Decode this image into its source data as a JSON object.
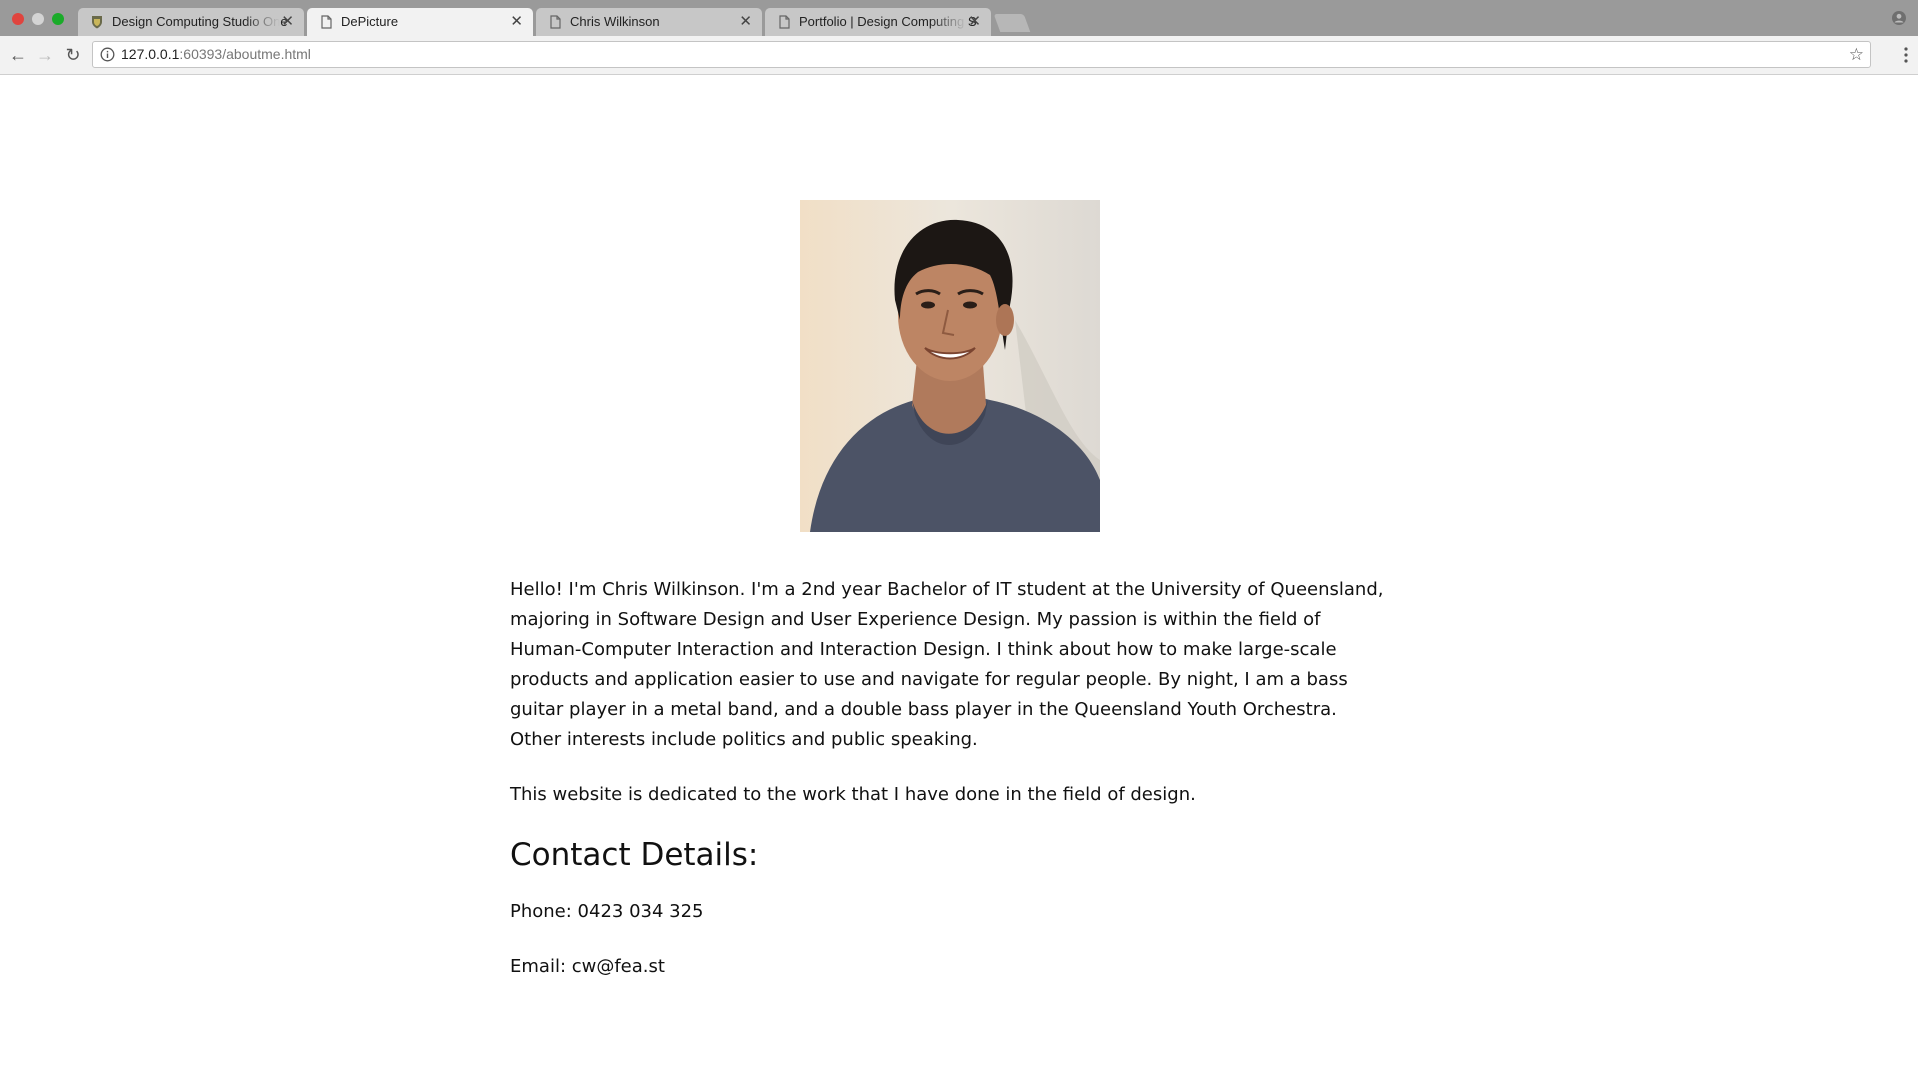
{
  "browser": {
    "tabs": [
      {
        "title": "Design Computing Studio One",
        "icon": "crest-icon",
        "active": false
      },
      {
        "title": "DePicture",
        "icon": "page-icon",
        "active": true
      },
      {
        "title": "Chris Wilkinson",
        "icon": "page-icon",
        "active": false
      },
      {
        "title": "Portfolio | Design Computing S",
        "icon": "page-icon",
        "active": false
      }
    ],
    "url_host": "127.0.0.1",
    "url_rest": ":60393/aboutme.html"
  },
  "page": {
    "photo_alt": "Chris Wilkinson portrait",
    "bio": "Hello! I'm Chris Wilkinson. I'm a 2nd year Bachelor of IT student at the University of Queensland, majoring in Software Design and User Experience Design. My passion is within the field of Human-Computer Interaction and Interaction Design. I think about how to make large-scale products and application easier to use and navigate for regular people. By night, I am a bass guitar player in a metal band, and a double bass player in the Queensland Youth Orchestra. Other interests include politics and public speaking.",
    "dedication": "This website is dedicated to the work that I have done in the field of design.",
    "contact_heading": "Contact Details:",
    "phone": "Phone: 0423 034 325",
    "email": "Email: cw@fea.st"
  },
  "colors": {
    "tabbar": "#9a9a9a",
    "toolbar": "#f2f2f2",
    "shirt": "#4c5366",
    "wall": "#e4e0d8"
  }
}
